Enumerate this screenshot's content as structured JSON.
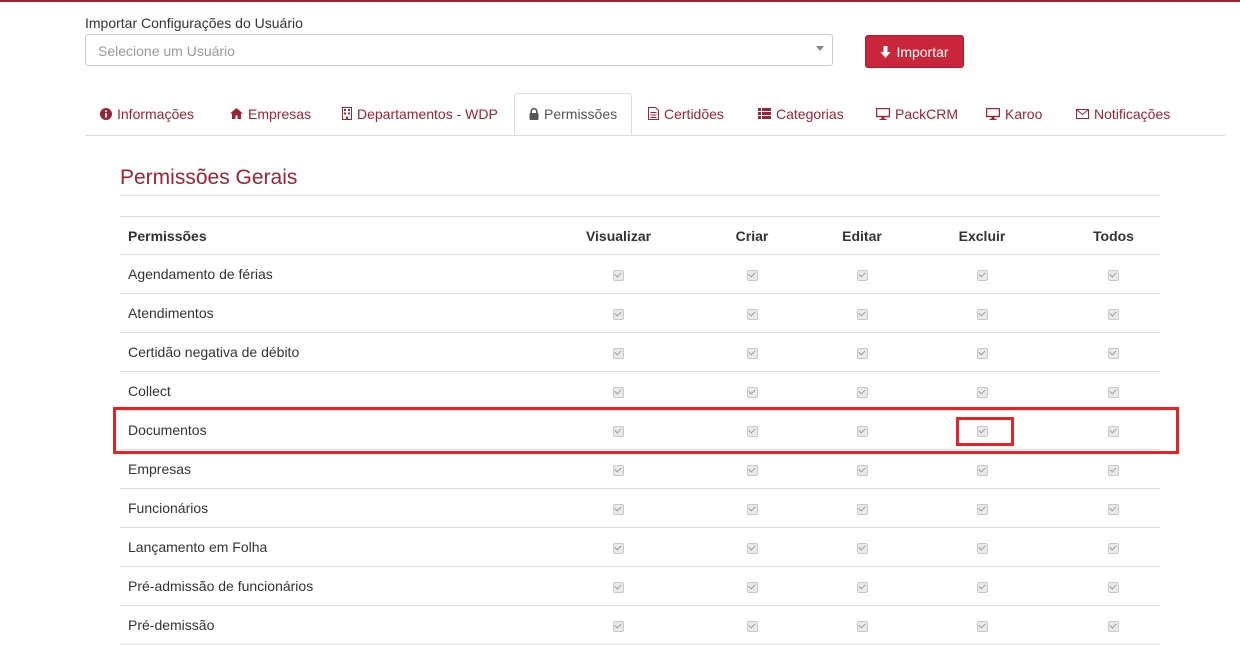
{
  "import": {
    "label": "Importar Configurações do Usuário",
    "select_placeholder": "Selecione um Usuário",
    "button_label": "Importar"
  },
  "tabs": [
    {
      "label": "Informações",
      "icon": "info-circle-icon",
      "active": false
    },
    {
      "label": "Empresas",
      "icon": "home-icon",
      "active": false
    },
    {
      "label": "Departamentos - WDP",
      "icon": "building-icon",
      "active": false
    },
    {
      "label": "Permissões",
      "icon": "lock-icon",
      "active": true
    },
    {
      "label": "Certidões",
      "icon": "file-text-icon",
      "active": false
    },
    {
      "label": "Categorias",
      "icon": "list-icon",
      "active": false
    },
    {
      "label": "PackCRM",
      "icon": "desktop-icon",
      "active": false
    },
    {
      "label": "Karoo",
      "icon": "desktop-icon",
      "active": false
    },
    {
      "label": "Notificações",
      "icon": "envelope-icon",
      "active": false
    }
  ],
  "section": {
    "title": "Permissões Gerais"
  },
  "table": {
    "headers": [
      "Permissões",
      "Visualizar",
      "Criar",
      "Editar",
      "Excluir",
      "Todos"
    ],
    "rows": [
      {
        "name": "Agendamento de férias",
        "checks": [
          true,
          true,
          true,
          true,
          true
        ]
      },
      {
        "name": "Atendimentos",
        "checks": [
          true,
          true,
          true,
          true,
          true
        ]
      },
      {
        "name": "Certidão negativa de débito",
        "checks": [
          true,
          true,
          true,
          true,
          true
        ]
      },
      {
        "name": "Collect",
        "checks": [
          true,
          true,
          true,
          true,
          true
        ]
      },
      {
        "name": "Documentos",
        "checks": [
          true,
          true,
          true,
          true,
          true
        ]
      },
      {
        "name": "Empresas",
        "checks": [
          true,
          true,
          true,
          true,
          true
        ]
      },
      {
        "name": "Funcionários",
        "checks": [
          true,
          true,
          true,
          true,
          true
        ]
      },
      {
        "name": "Lançamento em Folha",
        "checks": [
          true,
          true,
          true,
          true,
          true
        ]
      },
      {
        "name": "Pré-admissão de funcionários",
        "checks": [
          true,
          true,
          true,
          true,
          true
        ]
      },
      {
        "name": "Pré-demissão",
        "checks": [
          true,
          true,
          true,
          true,
          true
        ]
      }
    ]
  },
  "colors": {
    "accent": "#9b2335",
    "button": "#c9263b",
    "highlight": "#e0252a"
  }
}
